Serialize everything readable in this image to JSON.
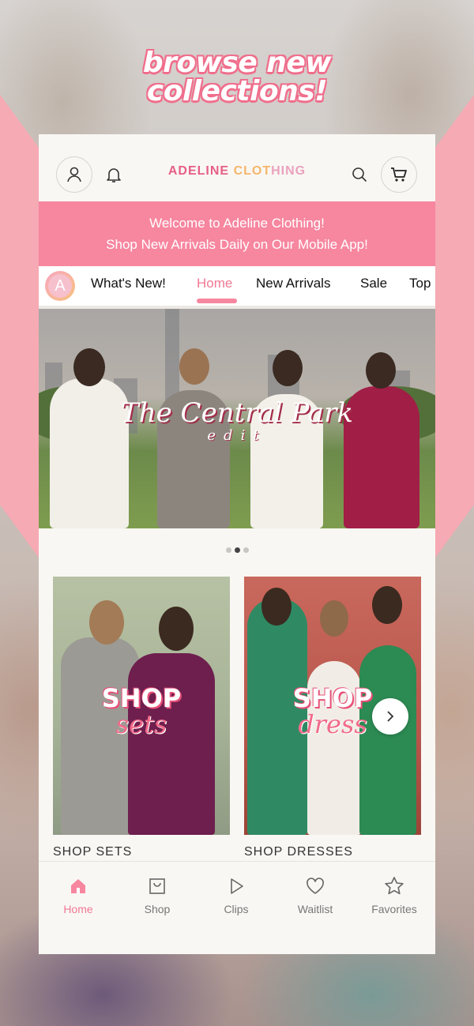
{
  "promo": {
    "line1": "browse new",
    "line2": "collections!"
  },
  "header": {
    "brand_part1": "ADELINE",
    "brand_part2": "CLOT",
    "brand_part3": "HING"
  },
  "welcome": {
    "line1": "Welcome to Adeline Clothing!",
    "line2": "Shop New Arrivals Daily on Our Mobile App!"
  },
  "tabs": {
    "avatar_letter": "A",
    "items": [
      "What's New!",
      "Home",
      "New Arrivals",
      "Sale",
      "Top"
    ],
    "active": "Home"
  },
  "hero": {
    "title": "The Central Park",
    "subtitle": "edit"
  },
  "carousel": {
    "pages": 3,
    "current_page": 2
  },
  "cards": [
    {
      "word": "SHOP",
      "script": "sets",
      "label": "SHOP SETS"
    },
    {
      "word": "SHOP",
      "script": "dress",
      "label": "SHOP DRESSES"
    }
  ],
  "nav": {
    "items": [
      "Home",
      "Shop",
      "Clips",
      "Waitlist",
      "Favorites"
    ],
    "active": "Home"
  },
  "colors": {
    "accent_pink": "#f7869f",
    "active_text": "#f07993",
    "brand_red": "#e65f84"
  }
}
